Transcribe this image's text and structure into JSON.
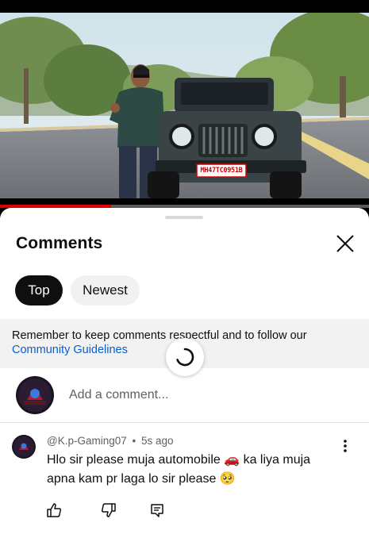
{
  "video": {
    "plate_text": "MH47TC0951B",
    "progress_fraction": 0.3
  },
  "comments_panel": {
    "title": "Comments",
    "filters": [
      "Top",
      "Newest"
    ],
    "selected_filter": "Top",
    "notice_text": "Remember to keep comments respectful and to follow our",
    "notice_link": "Community Guidelines",
    "add_comment_placeholder": "Add a comment..."
  },
  "comments": [
    {
      "author": "@K.p-Gaming07",
      "separator": "•",
      "time": "5s ago",
      "text_line1": "Hlo sir please muja automobile 🚗 ka liya muja",
      "text_line2": "apna kam pr laga lo sir please 🥺"
    }
  ],
  "colors": {
    "accent_red": "#e00000",
    "link_blue": "#065fd4",
    "chip_selected": "#0f0f0f",
    "chip_unselected": "#f1f1f1"
  },
  "icons": [
    "close-icon",
    "spinner-icon",
    "like-icon",
    "dislike-icon",
    "reply-icon",
    "more-vertical-icon"
  ]
}
